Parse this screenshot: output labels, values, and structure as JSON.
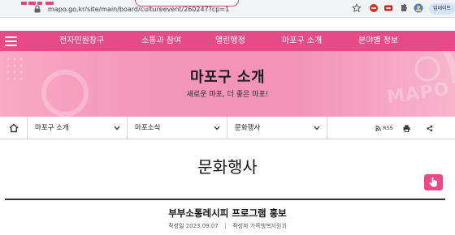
{
  "browser": {
    "url": "mapo.go.kr/site/main/board/cultureevent/260247?cp=1",
    "profile_label": "업데이트"
  },
  "nav": {
    "items": [
      "전자민원창구",
      "소통과 참여",
      "열린행정",
      "마포구 소개",
      "분야별 정보"
    ]
  },
  "banner": {
    "title": "마포구 소개",
    "subtitle": "새로운 마포, 더 좋은 마포!",
    "watermark": "MAPO"
  },
  "breadcrumb": {
    "level1": "마포구 소개",
    "level2": "마포소식",
    "level3": "문화행사",
    "rss_label": "RSS"
  },
  "page": {
    "title": "문화행사"
  },
  "post": {
    "title": "부부소통레시피 프로그램 홍보",
    "date_label": "작성일",
    "date": "2023.09.07",
    "author_label": "작성자",
    "author": "가족행복지원과"
  },
  "colors": {
    "brand_pink": "#e74b85",
    "banner_pink": "#f497b9"
  },
  "icons": [
    "lock-icon",
    "star-icon",
    "extension-icon",
    "hamburger-icon",
    "home-icon",
    "chevron-down-icon",
    "rss-icon",
    "print-icon",
    "share-icon",
    "hand-cursor-icon"
  ]
}
